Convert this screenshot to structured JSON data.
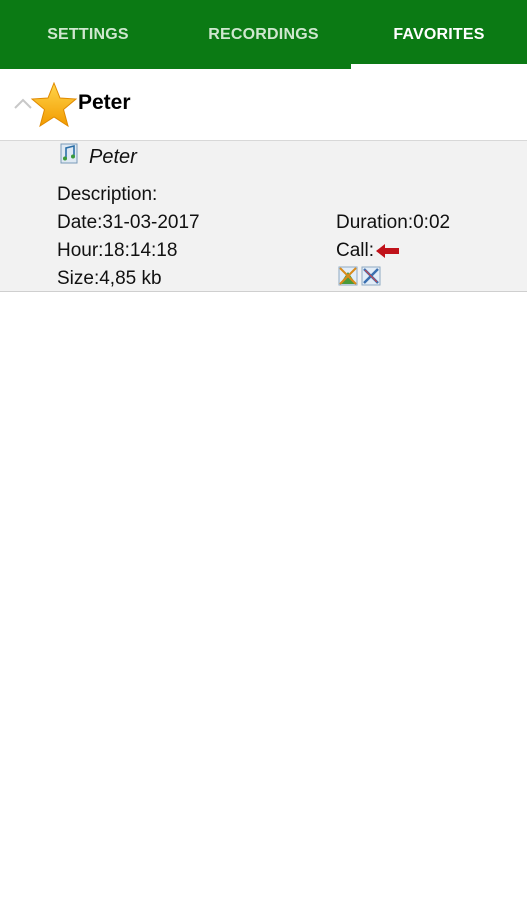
{
  "tabs": [
    {
      "label": "SETTINGS",
      "active": false
    },
    {
      "label": "RECORDINGS",
      "active": false
    },
    {
      "label": "FAVORITES",
      "active": true
    }
  ],
  "colors": {
    "tab_bar": "#0b7a14",
    "row_background": "#f2f2f2",
    "call_arrow": "#c0121a",
    "star": "#f5b400"
  },
  "group": {
    "title": "Peter",
    "icon": "star-icon",
    "toggle_icon": "chevron-up-icon"
  },
  "recording": {
    "name": "Peter",
    "icon": "music-file-icon",
    "description": "Description:",
    "date": "Date:31-03-2017",
    "hour": "Hour:18:14:18",
    "size": "Size:4,85 kb",
    "duration": "Duration:0:02",
    "call_label": "Call:",
    "call_direction_icon": "incoming-arrow-icon",
    "actions": [
      "share-icon",
      "delete-icon"
    ]
  }
}
